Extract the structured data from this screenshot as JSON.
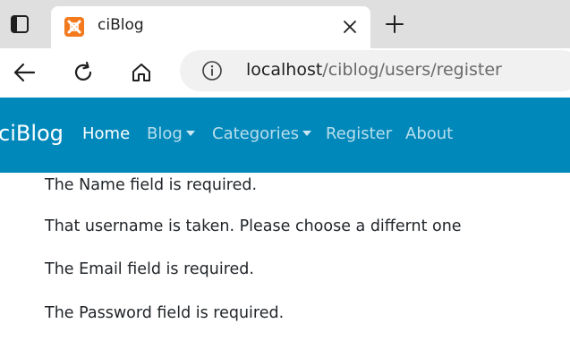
{
  "browser": {
    "tab": {
      "title": "ciBlog"
    },
    "address": {
      "host": "localhost",
      "path": "/ciblog/users/register"
    },
    "icons": {
      "tab_actions": "tab-actions-icon",
      "favicon": "xampp-favicon",
      "close": "close-icon",
      "new_tab": "plus-icon",
      "back": "back-arrow-icon",
      "refresh": "refresh-icon",
      "home": "home-icon",
      "info": "info-icon"
    }
  },
  "navbar": {
    "brand": "ciBlog",
    "items": [
      {
        "label": "Home"
      },
      {
        "label": "Blog"
      },
      {
        "label": "Categories"
      },
      {
        "label": "Register"
      },
      {
        "label": "About"
      }
    ],
    "color": "#0188bb"
  },
  "errors": [
    "The Name field is required.",
    "That username is taken. Please choose a differnt one",
    "The Email field is required.",
    "The Password field is required."
  ]
}
